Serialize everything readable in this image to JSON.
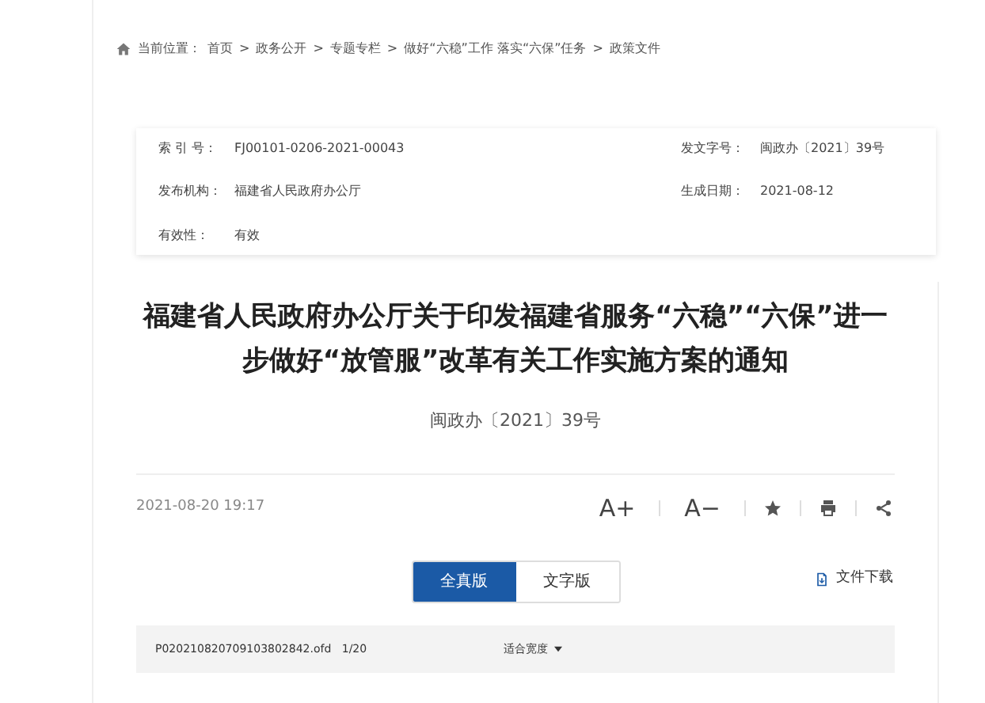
{
  "breadcrumb": {
    "label": "当前位置：",
    "items": [
      "首页",
      "政务公开",
      "专题专栏",
      "做好“六稳”工作 落实“六保”任务",
      "政策文件"
    ],
    "separator": ">"
  },
  "info": [
    {
      "label": "索 引 号：",
      "value": "FJ00101-0206-2021-00043"
    },
    {
      "label": "发文字号：",
      "value": "闽政办〔2021〕39号"
    },
    {
      "label": "发布机构：",
      "value": "福建省人民政府办公厅"
    },
    {
      "label": "生成日期：",
      "value": "2021-08-12"
    },
    {
      "label": "有效性：",
      "value": "有效"
    }
  ],
  "title": "福建省人民政府办公厅关于印发福建省服务“六稳”“六保”进一步做好“放管服”改革有关工作实施方案的通知",
  "doc_number": "闽政办〔2021〕39号",
  "date": "2021-08-20 19:17",
  "tools": [
    {
      "kind": "text",
      "label": "A+"
    },
    {
      "kind": "text",
      "label": "A−"
    },
    {
      "kind": "star"
    },
    {
      "kind": "print"
    },
    {
      "kind": "share"
    }
  ],
  "tabs": [
    {
      "label": "全真版",
      "selected": true
    },
    {
      "label": "文字版",
      "selected": false
    }
  ],
  "download": "文件下载",
  "viewer": {
    "file": "P020210820709103802842.ofd",
    "page": "1/20",
    "zoom": "适合宽度"
  }
}
